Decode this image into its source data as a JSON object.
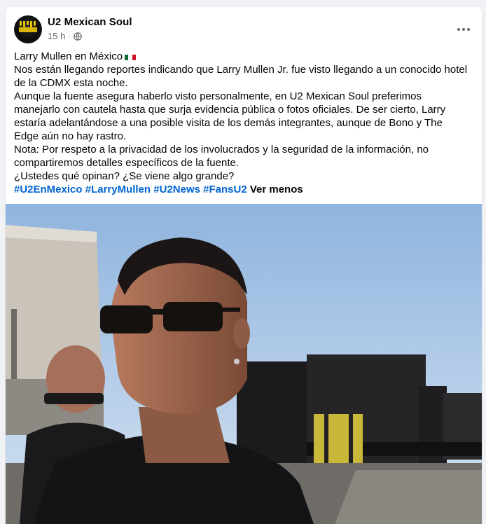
{
  "post": {
    "page_name": "U2 Mexican Soul",
    "timestamp": "15 h",
    "privacy_icon": "globe-icon",
    "more_icon": "more-options-icon",
    "title_line": "Larry Mullen en México",
    "flag_icon": "mexico-flag-icon",
    "paragraph1": "Nos están llegando reportes indicando que Larry Mullen Jr. fue visto llegando a un conocido hotel de la CDMX esta noche.",
    "paragraph2": "Aunque la fuente asegura haberlo visto personalmente, en U2 Mexican Soul preferimos manejarlo con cautela hasta que surja evidencia pública o fotos oficiales. De ser cierto, Larry estaría adelantándose a una posible visita de los demás integrantes, aunque de Bono y The Edge aún no hay rastro.",
    "paragraph3": "Nota: Por respeto a la privacidad de los involucrados y la seguridad de la información, no compartiremos detalles específicos de la fuente.",
    "paragraph4": "¿Ustedes qué opinan? ¿Se viene algo grande?",
    "hashtags": [
      "#U2EnMexico",
      "#LarryMullen",
      "#U2News",
      "#FansU2"
    ],
    "see_less": "Ver menos"
  },
  "colors": {
    "hashtag": "#0064d1",
    "secondary_text": "#65676b",
    "page_background": "#f0f2f5"
  }
}
